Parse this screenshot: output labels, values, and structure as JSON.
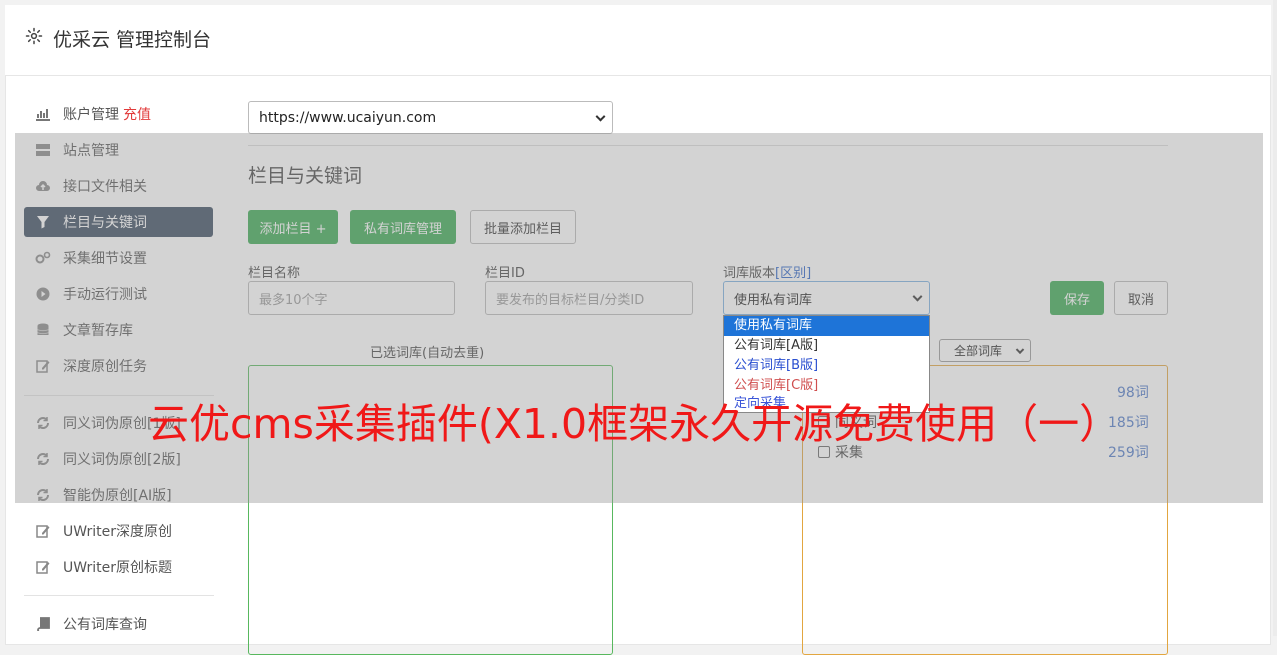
{
  "header": {
    "title": "优采云 管理控制台"
  },
  "sidebar": {
    "items": [
      {
        "label": "账户管理",
        "extra": "充值",
        "icon": "bar-chart-icon"
      },
      {
        "label": "站点管理",
        "icon": "server-icon"
      },
      {
        "label": "接口文件相关",
        "icon": "cloud-upload-icon"
      },
      {
        "label": "栏目与关键词",
        "icon": "filter-icon",
        "active": true
      },
      {
        "label": "采集细节设置",
        "icon": "gears-icon"
      },
      {
        "label": "手动运行测试",
        "icon": "play-icon"
      },
      {
        "label": "文章暂存库",
        "icon": "database-icon"
      },
      {
        "label": "深度原创任务",
        "icon": "edit-icon"
      },
      {
        "label": "同义词伪原创[1版]",
        "icon": "refresh-icon"
      },
      {
        "label": "同义词伪原创[2版]",
        "icon": "refresh-icon"
      },
      {
        "label": "智能伪原创[AI版]",
        "icon": "refresh-icon"
      },
      {
        "label": "UWriter深度原创",
        "icon": "edit-icon"
      },
      {
        "label": "UWriter原创标题",
        "icon": "edit-icon"
      },
      {
        "label": "公有词库查询",
        "icon": "book-icon"
      }
    ]
  },
  "site_select": {
    "value": "https://www.ucaiyun.com"
  },
  "section": {
    "title": "栏目与关键词"
  },
  "buttons": {
    "add_column": "添加栏目 +",
    "private_lexicon": "私有词库管理",
    "batch_add": "批量添加栏目",
    "save": "保存",
    "cancel": "取消"
  },
  "form": {
    "column_name_label": "栏目名称",
    "column_name_placeholder": "最多10个字",
    "column_id_label": "栏目ID",
    "column_id_placeholder": "要发布的目标栏目/分类ID",
    "lexicon_version_label": "词库版本",
    "lexicon_version_link": "[区别]",
    "lexicon_version_value": "使用私有词库"
  },
  "dropdown": {
    "options": [
      "使用私有词库",
      "公有词库[A版]",
      "公有词库[B版]",
      "公有词库[C版]",
      "定向采集"
    ],
    "option_colors": [
      "#ffffff",
      "#333333",
      "#2a4fd0",
      "#d04f4f",
      "#3a55d8"
    ]
  },
  "panels": {
    "selected_caption": "已选词库(自动去重)",
    "filter_value": "全部词库",
    "rows": [
      {
        "label": "",
        "count": "98词"
      },
      {
        "label": "同义词",
        "count": "185词"
      },
      {
        "label": "采集",
        "count": "259词"
      }
    ]
  },
  "overlay": {
    "text": "云优cms采集插件(X1.0框架永久开源免费使用（一）"
  },
  "colors": {
    "accent_green": "#3aaa52",
    "sidebar_active": "#3a4a60",
    "danger": "#e23a3a",
    "overlay_text": "#f01818"
  }
}
